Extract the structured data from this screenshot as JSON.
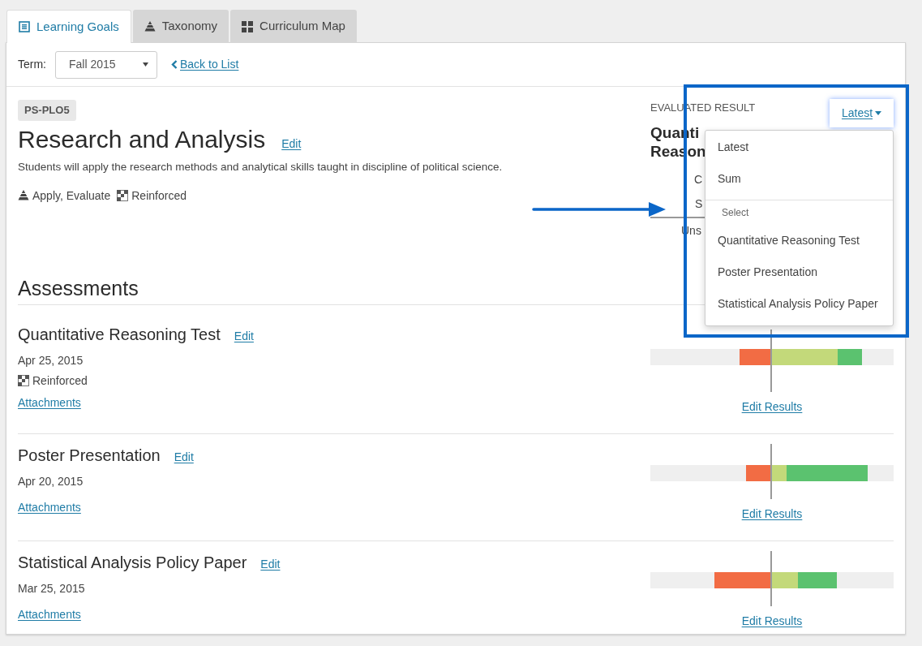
{
  "tabs": [
    {
      "kind": "list",
      "label": "Learning Goals",
      "selected": true
    },
    {
      "kind": "pyramid",
      "label": "Taxonomy",
      "selected": false
    },
    {
      "kind": "grid",
      "label": "Curriculum Map",
      "selected": false
    }
  ],
  "term": {
    "label": "Term:",
    "value": "Fall 2015"
  },
  "back_link": "Back to List",
  "goal": {
    "code": "PS-PLO5",
    "title": "Research and Analysis",
    "edit": "Edit",
    "description": "Students will apply the research methods and analytical skills taught in discipline of political science.",
    "tags": [
      {
        "kind": "taxonomy",
        "label": "Apply, Evaluate"
      },
      {
        "kind": "curriculum",
        "label": "Reinforced"
      }
    ]
  },
  "evaluated_result": {
    "heading": "EVALUATED RESULT",
    "title_lines": [
      "Quanti",
      "Reason"
    ],
    "fragments": [
      "C",
      "S",
      "Uns"
    ]
  },
  "result_menu": {
    "button": "Latest",
    "expanded": true,
    "items": [
      {
        "kind": "option",
        "label": "Latest"
      },
      {
        "kind": "option",
        "label": "Sum"
      },
      {
        "kind": "divider"
      },
      {
        "kind": "header",
        "label": "Select"
      },
      {
        "kind": "option",
        "label": "Quantitative Reasoning Test"
      },
      {
        "kind": "option",
        "label": "Poster Presentation"
      },
      {
        "kind": "option",
        "label": "Statistical Analysis Policy Paper"
      }
    ]
  },
  "assessments": {
    "heading": "Assessments",
    "items": [
      {
        "title": "Quantitative Reasoning Test",
        "edit": "Edit",
        "date": "Apr 25, 2015",
        "tags": [
          {
            "kind": "curriculum",
            "label": "Reinforced"
          }
        ],
        "attachments": "Attachments",
        "results_link": "Edit Results"
      },
      {
        "title": "Poster Presentation",
        "edit": "Edit",
        "date": "Apr 20, 2015",
        "attachments": "Attachments",
        "results_link": "Edit Results"
      },
      {
        "title": "Statistical Analysis Policy Paper",
        "edit": "Edit",
        "date": "Mar 25, 2015",
        "attachments": "Attachments",
        "results_link": "Edit Results"
      }
    ]
  }
}
